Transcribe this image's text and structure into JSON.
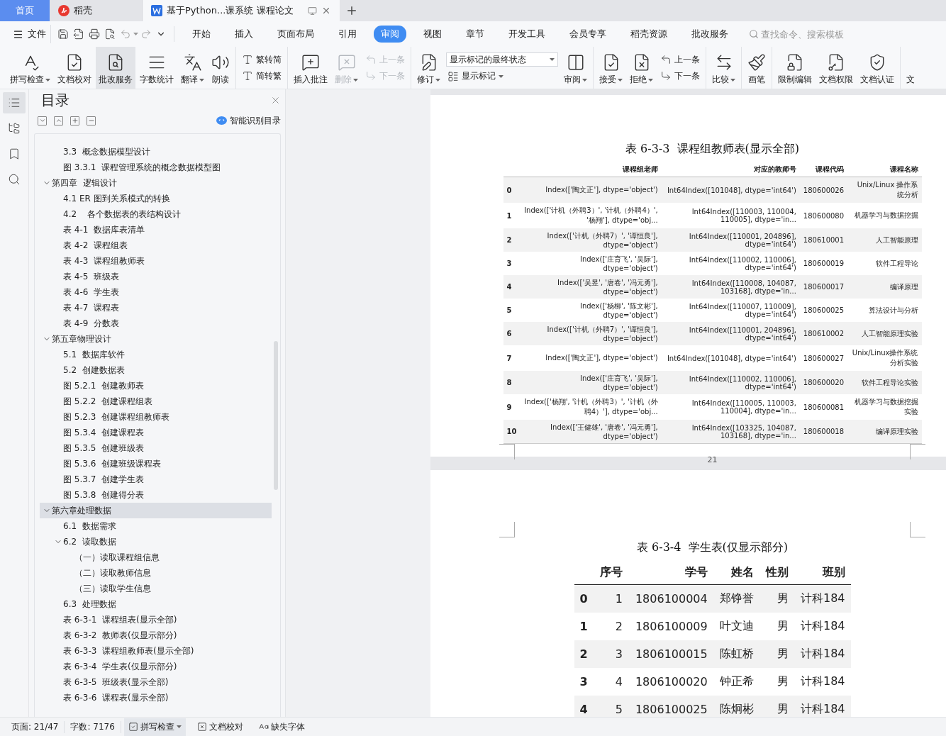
{
  "app_tabs": [
    {
      "label": "首页",
      "kind": "home",
      "selected": false
    },
    {
      "label": "稻壳",
      "kind": "docer",
      "selected": false
    },
    {
      "label": "基于Python...课系统 课程论文",
      "kind": "document",
      "selected": true
    }
  ],
  "menu": {
    "file": "文件",
    "tabs": [
      {
        "label": "开始",
        "selected": false
      },
      {
        "label": "插入",
        "selected": false
      },
      {
        "label": "页面布局",
        "selected": false
      },
      {
        "label": "引用",
        "selected": false
      },
      {
        "label": "审阅",
        "selected": true
      },
      {
        "label": "视图",
        "selected": false
      },
      {
        "label": "章节",
        "selected": false
      },
      {
        "label": "开发工具",
        "selected": false
      },
      {
        "label": "会员专享",
        "selected": false
      },
      {
        "label": "稻壳资源",
        "selected": false
      },
      {
        "label": "批改服务",
        "selected": false
      }
    ],
    "search": {
      "placeholder": "查找命令、搜索模板"
    }
  },
  "ribbon": [
    {
      "items": [
        {
          "kind": "big",
          "label": "拼写检查",
          "caret": true,
          "active": false,
          "disabled": false
        },
        {
          "kind": "big",
          "label": "文档校对",
          "caret": false,
          "active": false,
          "disabled": false
        },
        {
          "kind": "big",
          "label": "批改服务",
          "caret": false,
          "active": true,
          "disabled": false
        },
        {
          "kind": "big",
          "label": "字数统计",
          "caret": false,
          "active": false,
          "disabled": false
        },
        {
          "kind": "big",
          "label": "翻译",
          "caret": true,
          "active": false,
          "disabled": false
        },
        {
          "kind": "big",
          "label": "朗读",
          "caret": false,
          "active": false,
          "disabled": false
        }
      ]
    },
    {
      "items": [
        {
          "kind": "stack",
          "entries": [
            {
              "kind": "small",
              "label": "繁转简",
              "caret": false,
              "disabled": false
            },
            {
              "kind": "small",
              "label": "简转繁",
              "caret": false,
              "disabled": false
            }
          ]
        }
      ]
    },
    {
      "items": [
        {
          "kind": "big",
          "label": "插入批注",
          "caret": false,
          "active": false,
          "disabled": false
        },
        {
          "kind": "big",
          "label": "删除",
          "caret": true,
          "active": false,
          "disabled": true
        },
        {
          "kind": "stack",
          "entries": [
            {
              "kind": "small",
              "label": "上一条",
              "caret": false,
              "disabled": true
            },
            {
              "kind": "small",
              "label": "下一条",
              "caret": false,
              "disabled": true
            }
          ]
        }
      ]
    },
    {
      "items": [
        {
          "kind": "big",
          "label": "修订",
          "caret": true,
          "active": false,
          "disabled": false
        },
        {
          "kind": "stack",
          "entries": [
            {
              "kind": "select",
              "value": "显示标记的最终状态"
            },
            {
              "kind": "small",
              "label": "显示标记",
              "caret": true,
              "disabled": false
            }
          ]
        },
        {
          "kind": "big",
          "label": "审阅",
          "caret": true,
          "active": false,
          "disabled": false
        }
      ]
    },
    {
      "items": [
        {
          "kind": "big",
          "label": "接受",
          "caret": true,
          "active": false,
          "disabled": false
        },
        {
          "kind": "big",
          "label": "拒绝",
          "caret": true,
          "active": false,
          "disabled": false
        },
        {
          "kind": "stack",
          "entries": [
            {
              "kind": "small",
              "label": "上一条",
              "caret": false,
              "disabled": false
            },
            {
              "kind": "small",
              "label": "下一条",
              "caret": false,
              "disabled": false
            }
          ]
        }
      ]
    },
    {
      "items": [
        {
          "kind": "big",
          "label": "比较",
          "caret": true,
          "active": false,
          "disabled": false
        }
      ]
    },
    {
      "items": [
        {
          "kind": "big",
          "label": "画笔",
          "caret": false,
          "active": false,
          "disabled": false
        }
      ]
    },
    {
      "items": [
        {
          "kind": "big",
          "label": "限制编辑",
          "caret": false,
          "active": false,
          "disabled": false
        },
        {
          "kind": "big",
          "label": "文档权限",
          "caret": false,
          "active": false,
          "disabled": false
        },
        {
          "kind": "big",
          "label": "文档认证",
          "caret": false,
          "active": false,
          "disabled": false
        }
      ]
    },
    {
      "items": [
        {
          "kind": "big",
          "label": "文",
          "caret": false,
          "active": false,
          "disabled": false
        }
      ]
    }
  ],
  "rail": [
    {
      "selected": true
    },
    {
      "selected": false
    },
    {
      "selected": false
    },
    {
      "selected": false
    }
  ],
  "toc": {
    "title": "目录",
    "smart_button": "智能识别目录",
    "items": [
      {
        "children": [
          {
            "label": "3.3  概念数据模型设计",
            "selected": false
          },
          {
            "label": "图 3.3.1  课程管理系统的概念数据模型图",
            "selected": false
          }
        ]
      },
      {
        "label": "第四章  逻辑设计",
        "selected": false,
        "expanded": true,
        "children": [
          {
            "label": "4.1 ER 图到关系模式的转换",
            "selected": false
          },
          {
            "label": "4.2    各个数据表的表结构设计",
            "selected": false
          },
          {
            "label": "表 4-1  数据库表清单",
            "selected": false
          },
          {
            "label": "表 4-2  课程组表",
            "selected": false
          },
          {
            "label": "表 4-3  课程组教师表",
            "selected": false
          },
          {
            "label": "表 4-5  班级表",
            "selected": false
          },
          {
            "label": "表 4-6  学生表",
            "selected": false
          },
          {
            "label": "表 4-7  课程表",
            "selected": false
          },
          {
            "label": "表 4-9  分数表",
            "selected": false
          }
        ]
      },
      {
        "label": "第五章物理设计",
        "selected": false,
        "expanded": true,
        "children": [
          {
            "label": "5.1  数据库软件",
            "selected": false
          },
          {
            "label": "5.2  创建数据表",
            "selected": false
          },
          {
            "label": "图 5.2.1  创建教师表",
            "selected": false
          },
          {
            "label": "图 5.2.2  创建课程组表",
            "selected": false
          },
          {
            "label": "图 5.2.3  创建课程组教师表",
            "selected": false
          },
          {
            "label": "图 5.3.4  创建课程表",
            "selected": false
          },
          {
            "label": "图 5.3.5  创建班级表",
            "selected": false
          },
          {
            "label": "图 5.3.6  创建班级课程表",
            "selected": false
          },
          {
            "label": "图 5.3.7  创建学生表",
            "selected": false
          },
          {
            "label": "图 5.3.8  创建得分表",
            "selected": false
          }
        ]
      },
      {
        "label": "第六章处理数据",
        "selected": true,
        "expanded": true,
        "children": [
          {
            "label": "6.1  数据需求",
            "selected": false
          },
          {
            "label": "6.2  读取数据",
            "selected": false,
            "expanded": true,
            "children": [
              {
                "label": "（一）读取课程组信息",
                "selected": false
              },
              {
                "label": "（二）读取教师信息",
                "selected": false
              },
              {
                "label": "（三）读取学生信息",
                "selected": false
              }
            ]
          },
          {
            "label": "6.3  处理数据",
            "selected": false
          },
          {
            "label": "表 6-3-1  课程组表(显示全部)",
            "selected": false
          },
          {
            "label": "表 6-3-2  教师表(仅显示部分)",
            "selected": false
          },
          {
            "label": "表 6-3-3  课程组教师表(显示全部)",
            "selected": false
          },
          {
            "label": "表 6-3-4  学生表(仅显示部分)",
            "selected": false
          },
          {
            "label": "表 6-3-5  班级表(显示全部)",
            "selected": false
          },
          {
            "label": "表 6-3-6  课程表(显示全部)",
            "selected": false
          }
        ]
      }
    ]
  },
  "pages": [
    {
      "kind": "small",
      "caption": "表 6-3-3  课程组教师表(显示全部)",
      "columns": [
        "课程组老师",
        "对应的教师号",
        "课程代码",
        "课程名称"
      ],
      "page_number": "21",
      "rows": [
        {
          "index": "0",
          "cells": [
            "Index(['陶文正'], dtype='object')",
            "Int64Index([101048], dtype='int64')",
            "180600026",
            "Unix/Linux 操作系统分析"
          ]
        },
        {
          "index": "1",
          "cells": [
            "Index(['计机（外聘3）', '计机（外聘4）', '杨翔'], dtype='obj...",
            "Int64Index([110003, 110004, 110005], dtype='in...",
            "180600080",
            "机器学习与数据挖掘"
          ]
        },
        {
          "index": "2",
          "cells": [
            "Index(['计机（外聘7）', '谭恒良'], dtype='object')",
            "Int64Index([110001, 204896], dtype='int64')",
            "180610001",
            "人工智能原理"
          ]
        },
        {
          "index": "3",
          "cells": [
            "Index(['庄育飞', '吴际'], dtype='object')",
            "Int64Index([110002, 110006], dtype='int64')",
            "180600019",
            "软件工程导论"
          ]
        },
        {
          "index": "4",
          "cells": [
            "Index(['吴昱', '唐卷', '冯元勇'], dtype='object')",
            "Int64Index([110008, 104087, 103168], dtype='in...",
            "180600017",
            "编译原理"
          ]
        },
        {
          "index": "5",
          "cells": [
            "Index(['杨柳', '陈文彬'], dtype='object')",
            "Int64Index([110007, 110009], dtype='int64')",
            "180600025",
            "算法设计与分析"
          ]
        },
        {
          "index": "6",
          "cells": [
            "Index(['计机（外聘7）', '谭恒良'], dtype='object')",
            "Int64Index([110001, 204896], dtype='int64')",
            "180610002",
            "人工智能原理实验"
          ]
        },
        {
          "index": "7",
          "cells": [
            "Index(['陶文正'], dtype='object')",
            "Int64Index([101048], dtype='int64')",
            "180600027",
            "Unix/Linux操作系统分析实验"
          ]
        },
        {
          "index": "8",
          "cells": [
            "Index(['庄育飞', '吴际'], dtype='object')",
            "Int64Index([110002, 110006], dtype='int64')",
            "180600020",
            "软件工程导论实验"
          ]
        },
        {
          "index": "9",
          "cells": [
            "Index(['杨翔', '计机（外聘3）', '计机（外聘4）'], dtype='obj...",
            "Int64Index([110005, 110003, 110004], dtype='in...",
            "180600081",
            "机器学习与数据挖掘实验"
          ]
        },
        {
          "index": "10",
          "cells": [
            "Index(['王健雄', '唐卷', '冯元勇'], dtype='object')",
            "Int64Index([103325, 104087, 103168], dtype='in...",
            "180600018",
            "编译原理实验"
          ]
        }
      ]
    },
    {
      "kind": "large",
      "caption": "表 6-3-4  学生表(仅显示部分)",
      "columns": [
        "序号",
        "学号",
        "姓名",
        "性别",
        "班别"
      ],
      "rows": [
        {
          "index": "0",
          "cells": [
            "1",
            "1806100004",
            "郑铮誉",
            "男",
            "计科184"
          ]
        },
        {
          "index": "1",
          "cells": [
            "2",
            "1806100009",
            "叶文迪",
            "男",
            "计科184"
          ]
        },
        {
          "index": "2",
          "cells": [
            "3",
            "1806100015",
            "陈虹桥",
            "男",
            "计科184"
          ]
        },
        {
          "index": "3",
          "cells": [
            "4",
            "1806100020",
            "钟正希",
            "男",
            "计科184"
          ]
        },
        {
          "index": "4",
          "cells": [
            "5",
            "1806100025",
            "陈炯彬",
            "男",
            "计科184"
          ]
        }
      ]
    }
  ],
  "status_bar": {
    "page": "页面: 21/47",
    "words": "字数: 7176",
    "items": [
      {
        "label": "拼写检查",
        "caret": true,
        "active": true
      },
      {
        "label": "文档校对",
        "caret": false,
        "active": false
      },
      {
        "label": "缺失字体",
        "caret": false,
        "active": false
      }
    ]
  }
}
